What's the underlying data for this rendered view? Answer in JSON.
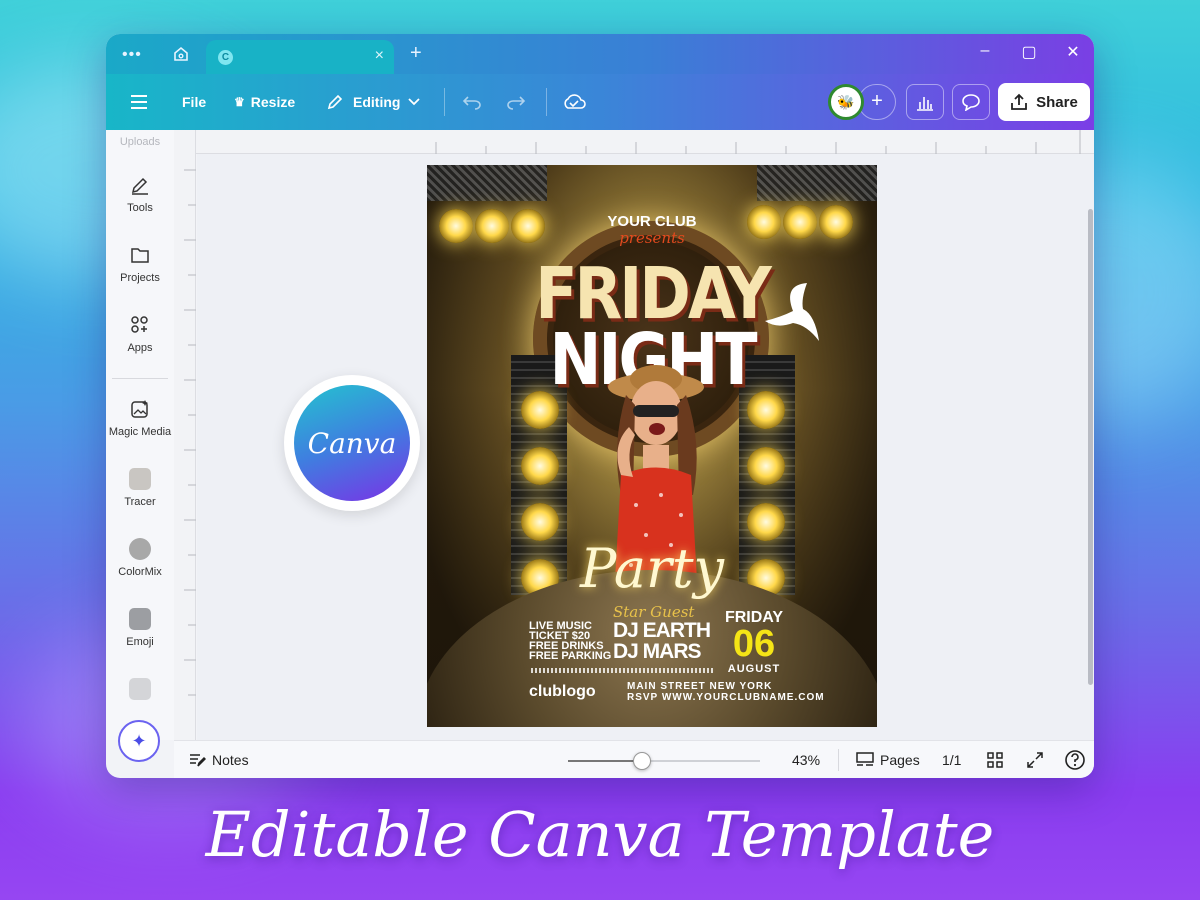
{
  "toolbar": {
    "file": "File",
    "resize": "Resize",
    "editing": "Editing",
    "share": "Share"
  },
  "sidebar": {
    "items": [
      {
        "label": "Uploads"
      },
      {
        "label": "Tools"
      },
      {
        "label": "Projects"
      },
      {
        "label": "Apps"
      },
      {
        "label": "Magic Media"
      },
      {
        "label": "Tracer"
      },
      {
        "label": "ColorMix"
      },
      {
        "label": "Emoji"
      }
    ]
  },
  "badge": {
    "text": "Canva"
  },
  "flyer": {
    "club": "YOUR CLUB",
    "presents": "presents",
    "title_line1": "FRIDAY",
    "title_line2": "NIGHT",
    "party": "Party",
    "info": [
      "LIVE MUSIC",
      "TICKET $20",
      "FREE DRINKS",
      "FREE PARKING"
    ],
    "star_guest": "Star Guest",
    "dj1": "DJ EARTH",
    "dj2": "DJ MARS",
    "day": "FRIDAY",
    "date": "06",
    "month": "AUGUST",
    "logo": "clublogo",
    "address": "MAIN STREET NEW YORK",
    "rsvp": "RSVP WWW.YOURCLUBNAME.COM"
  },
  "bottombar": {
    "notes": "Notes",
    "zoom": "43%",
    "zoom_value": 0.43,
    "pages_label": "Pages",
    "page_count": "1/1"
  },
  "footer": {
    "title": "Editable Canva Template"
  },
  "colors": {
    "accent_teal": "#18b6c8",
    "accent_purple": "#7b3ee6",
    "date_yellow": "#f5e516"
  }
}
